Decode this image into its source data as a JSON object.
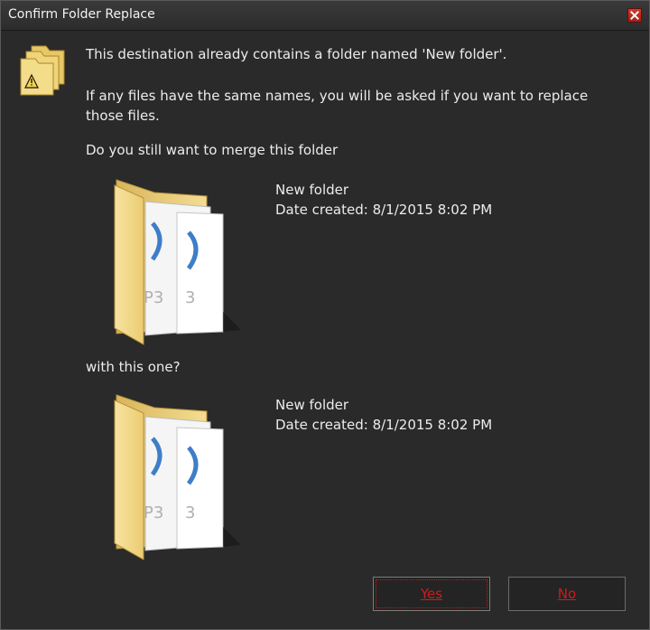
{
  "window": {
    "title": "Confirm Folder Replace"
  },
  "icons": {
    "warning": "warning-folder-icon",
    "folder": "folder-with-mp3-files-icon",
    "close": "close-icon"
  },
  "message": {
    "line1": "This destination already contains a folder named 'New folder'.",
    "line2a": "If any files have the same names, you will be asked if you want to replace",
    "line2b": "those files.",
    "question": "Do you still want to merge this folder",
    "with_text": "with this one?"
  },
  "source_folder": {
    "name": "New folder",
    "date": "Date created: 8/1/2015 8:02 PM"
  },
  "dest_folder": {
    "name": "New folder",
    "date": "Date created: 8/1/2015 8:02 PM"
  },
  "buttons": {
    "yes": "Yes",
    "no": "No"
  },
  "colors": {
    "background": "#2a2a2a",
    "text": "#ececec",
    "button_text": "#d01b1b",
    "close_button": "#c8291c"
  }
}
